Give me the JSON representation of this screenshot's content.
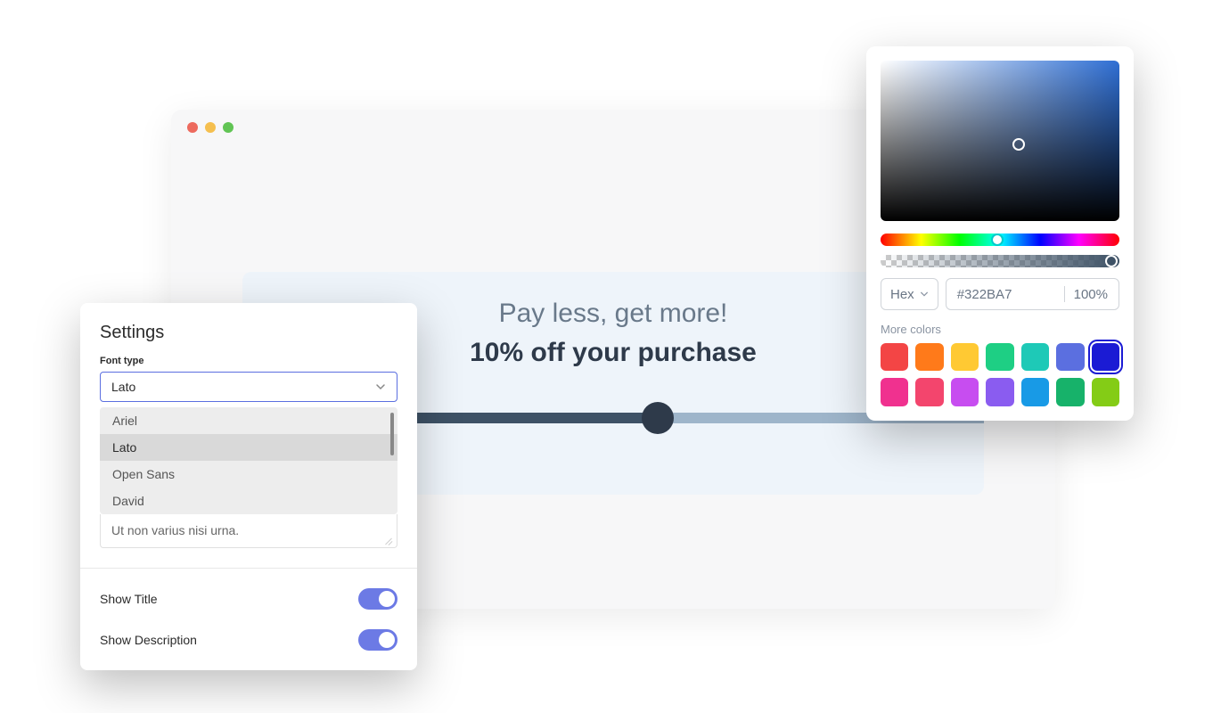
{
  "browser": {
    "card": {
      "title": "Pay less, get more!",
      "subtitle": "10% off your purchase"
    }
  },
  "settings": {
    "heading": "Settings",
    "font_type_label": "Font type",
    "selected_font": "Lato",
    "font_options": [
      "Ariel",
      "Lato",
      "Open Sans",
      "David"
    ],
    "textarea_value": "Ut non varius nisi urna.",
    "show_title_label": "Show Title",
    "show_description_label": "Show Description"
  },
  "color_picker": {
    "format_label": "Hex",
    "hex_value": "#322BA7",
    "alpha_value": "100%",
    "more_colors_label": "More colors",
    "swatches": [
      "#f34545",
      "#ff7a1a",
      "#ffc933",
      "#1ecf84",
      "#1ec9b7",
      "#5b6fe0",
      "#1b1bd4",
      "#f0318f",
      "#f3456d",
      "#c74df0",
      "#8a5cf0",
      "#189ae6",
      "#17b26a",
      "#84cc16"
    ],
    "selected_swatch_index": 6
  }
}
